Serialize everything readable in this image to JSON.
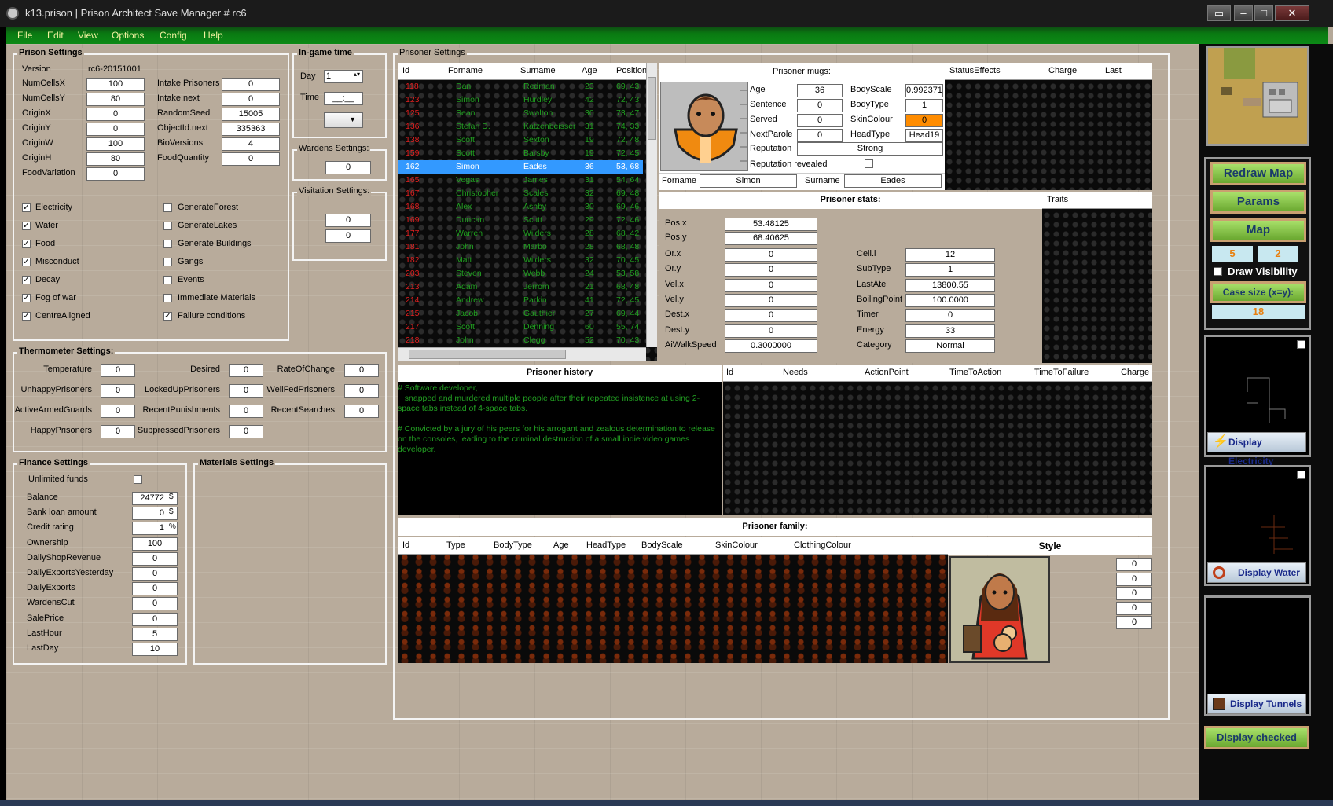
{
  "window": {
    "title": "k13.prison | Prison Architect Save Manager # rc6"
  },
  "menu": [
    "File",
    "Edit",
    "View",
    "Options",
    "Config",
    "Help"
  ],
  "prison_settings": {
    "title": "Prison Settings",
    "version_label": "Version",
    "version": "rc6-20151001",
    "left": [
      {
        "label": "NumCellsX",
        "value": "100"
      },
      {
        "label": "NumCellsY",
        "value": "80"
      },
      {
        "label": "OriginX",
        "value": "0"
      },
      {
        "label": "OriginY",
        "value": "0"
      },
      {
        "label": "OriginW",
        "value": "100"
      },
      {
        "label": "OriginH",
        "value": "80"
      },
      {
        "label": "FoodVariation",
        "value": "0"
      }
    ],
    "right": [
      {
        "label": "Intake Prisoners",
        "value": "0"
      },
      {
        "label": "Intake.next",
        "value": "0"
      },
      {
        "label": "RandomSeed",
        "value": "15005"
      },
      {
        "label": "ObjectId.next",
        "value": "335363"
      },
      {
        "label": "BioVersions",
        "value": "4"
      },
      {
        "label": "FoodQuantity",
        "value": "0"
      }
    ],
    "checks_left": [
      {
        "label": "Electricity",
        "checked": "✓"
      },
      {
        "label": "Water",
        "checked": "✓"
      },
      {
        "label": "Food",
        "checked": "✓"
      },
      {
        "label": "Misconduct",
        "checked": "✓"
      },
      {
        "label": "Decay",
        "checked": "✓"
      },
      {
        "label": "Fog of war",
        "checked": "✓"
      },
      {
        "label": "CentreAligned",
        "checked": "✓"
      }
    ],
    "checks_right": [
      {
        "label": "GenerateForest",
        "checked": ""
      },
      {
        "label": "GenerateLakes",
        "checked": ""
      },
      {
        "label": "Generate Buildings",
        "checked": ""
      },
      {
        "label": "Gangs",
        "checked": ""
      },
      {
        "label": "Events",
        "checked": ""
      },
      {
        "label": "Immediate Materials",
        "checked": ""
      },
      {
        "label": "Failure conditions",
        "checked": "✓"
      }
    ]
  },
  "ingame": {
    "title": "In-game time",
    "day_label": "Day",
    "day": "1",
    "time_label": "Time",
    "time": "__:__"
  },
  "wardens": {
    "title": "Wardens Settings:",
    "value": "0"
  },
  "visitation": {
    "title": "Visitation Settings:",
    "v1": "0",
    "v2": "0"
  },
  "thermometer": {
    "title": "Thermometer Settings:",
    "col1": [
      {
        "label": "Temperature",
        "value": "0"
      },
      {
        "label": "UnhappyPrisoners",
        "value": "0"
      },
      {
        "label": "ActiveArmedGuards",
        "value": "0"
      },
      {
        "label": "HappyPrisoners",
        "value": "0"
      }
    ],
    "col2": [
      {
        "label": "Desired",
        "value": "0"
      },
      {
        "label": "LockedUpPrisoners",
        "value": "0"
      },
      {
        "label": "RecentPunishments",
        "value": "0"
      },
      {
        "label": "SuppressedPrisoners",
        "value": "0"
      }
    ],
    "col3": [
      {
        "label": "RateOfChange",
        "value": "0"
      },
      {
        "label": "WellFedPrisoners",
        "value": "0"
      },
      {
        "label": "RecentSearches",
        "value": "0"
      }
    ]
  },
  "finance": {
    "title": "Finance Settings",
    "unlimited": "Unlimited funds",
    "rows": [
      {
        "label": "Balance",
        "value": "24772",
        "unit": "$"
      },
      {
        "label": "Bank loan amount",
        "value": "0",
        "unit": "$"
      },
      {
        "label": "Credit rating",
        "value": "1",
        "unit": "%"
      },
      {
        "label": "Ownership",
        "value": "100",
        "unit": ""
      },
      {
        "label": "DailyShopRevenue",
        "value": "0",
        "unit": ""
      },
      {
        "label": "DailyExportsYesterday",
        "value": "0",
        "unit": ""
      },
      {
        "label": "DailyExports",
        "value": "0",
        "unit": ""
      },
      {
        "label": "WardensCut",
        "value": "0",
        "unit": ""
      },
      {
        "label": "SalePrice",
        "value": "0",
        "unit": ""
      },
      {
        "label": "LastHour",
        "value": "5",
        "unit": ""
      },
      {
        "label": "LastDay",
        "value": "10",
        "unit": ""
      }
    ]
  },
  "materials": {
    "title": "Materials Settings"
  },
  "prisoner_settings": {
    "title": "Prisoner Settings",
    "columns": [
      "Id",
      "Forname",
      "Surname",
      "Age",
      "Position"
    ],
    "rows": [
      [
        "118",
        "Dan",
        "Redman",
        "23",
        "69, 43"
      ],
      [
        "123",
        "Simon",
        "Hurdley",
        "42",
        "72, 43"
      ],
      [
        "125",
        "Sean",
        "Swalton",
        "30",
        "73, 47"
      ],
      [
        "136",
        "Stefan D.",
        "Katzenbeisser",
        "31",
        "74, 33"
      ],
      [
        "138",
        "Scott",
        "Sexton",
        "19",
        "72, 48"
      ],
      [
        "159",
        "Scott",
        "Barsby",
        "19",
        "72, 45"
      ],
      [
        "162",
        "Simon",
        "Eades",
        "36",
        "53, 68"
      ],
      [
        "165",
        "Vegas",
        "James",
        "31",
        "54, 64"
      ],
      [
        "167",
        "Christopher",
        "Scales",
        "32",
        "69, 48"
      ],
      [
        "168",
        "Alex",
        "Ashby",
        "30",
        "69, 46"
      ],
      [
        "169",
        "Duncan",
        "Scutt",
        "29",
        "72, 46"
      ],
      [
        "177",
        "Warren",
        "Wilders",
        "28",
        "68, 42"
      ],
      [
        "181",
        "John",
        "Marbo",
        "28",
        "68, 48"
      ],
      [
        "182",
        "Matt",
        "Wilders",
        "32",
        "70, 45"
      ],
      [
        "203",
        "Steven",
        "Webb",
        "24",
        "53, 58"
      ],
      [
        "213",
        "Adam",
        "Jerrom",
        "21",
        "68, 48"
      ],
      [
        "214",
        "Andrew",
        "Parkin",
        "41",
        "72, 45"
      ],
      [
        "215",
        "Jacob",
        "Gauthier",
        "27",
        "69, 44"
      ],
      [
        "217",
        "Scott",
        "Denning",
        "60",
        "55, 74"
      ],
      [
        "218",
        "John",
        "Clegg",
        "52",
        "70, 43"
      ]
    ],
    "selected_row": "6"
  },
  "mugs": {
    "title": "Prisoner mugs:",
    "fields": [
      {
        "label": "Age",
        "value": "36"
      },
      {
        "label": "Sentence",
        "value": "0"
      },
      {
        "label": "Served",
        "value": "0"
      },
      {
        "label": "NextParole",
        "value": "0"
      }
    ],
    "fields2": [
      {
        "label": "BodyScale",
        "value": "0.992371"
      },
      {
        "label": "BodyType",
        "value": "1"
      },
      {
        "label": "SkinColour",
        "value": "0"
      },
      {
        "label": "HeadType",
        "value": "Head19"
      }
    ],
    "reputation_label": "Reputation",
    "reputation": "Strong",
    "revealed": "Reputation revealed",
    "forname_label": "Forname",
    "forname": "Simon",
    "surname_label": "Surname",
    "surname": "Eades",
    "skin_color": "#ff8c00"
  },
  "status_cols": [
    "StatusEffects",
    "Charge",
    "Last"
  ],
  "stats": {
    "title": "Prisoner stats:",
    "traits": "Traits",
    "pos": [
      {
        "label": "Pos.x",
        "value": "53.48125"
      },
      {
        "label": "Pos.y",
        "value": "68.40625"
      }
    ],
    "left": [
      {
        "label": "Or.x",
        "value": "0"
      },
      {
        "label": "Or.y",
        "value": "0"
      },
      {
        "label": "Vel.x",
        "value": "0"
      },
      {
        "label": "Vel.y",
        "value": "0"
      },
      {
        "label": "Dest.x",
        "value": "0"
      },
      {
        "label": "Dest.y",
        "value": "0"
      },
      {
        "label": "AiWalkSpeed",
        "value": "0.3000000"
      }
    ],
    "right": [
      {
        "label": "Cell.i",
        "value": "12"
      },
      {
        "label": "SubType",
        "value": "1"
      },
      {
        "label": "LastAte",
        "value": "13800.55"
      },
      {
        "label": "BoilingPoint",
        "value": "100.0000"
      },
      {
        "label": "Timer",
        "value": "0"
      },
      {
        "label": "Energy",
        "value": "33"
      },
      {
        "label": "Category",
        "value": "Normal"
      }
    ]
  },
  "history": {
    "title": "Prisoner history",
    "text": "# Software developer,\n   snapped and murdered multiple people after their repeated insistence at using 2-space tabs instead of 4-space tabs.\n\n# Convicted by a jury of his peers for his arrogant and zealous determination to release on the consoles, leading to the criminal destruction of a small indie video games developer."
  },
  "needs_cols": [
    "Id",
    "Needs",
    "ActionPoint",
    "TimeToAction",
    "TimeToFailure",
    "Charge"
  ],
  "family": {
    "title": "Prisoner family:",
    "cols": [
      "Id",
      "Type",
      "BodyType",
      "Age",
      "HeadType",
      "BodyScale",
      "SkinColour",
      "ClothingColour"
    ],
    "style": "Style",
    "values": [
      "0",
      "0",
      "0",
      "0",
      "0"
    ]
  },
  "sidebar": {
    "redraw": "Redraw Map",
    "params": "Params",
    "map": "Map",
    "v1": "5",
    "v2": "2",
    "draw_visibility": "Draw Visibility",
    "case_size": "Case size (x=y):",
    "case_value": "18",
    "electricity": "Display Electricity",
    "water": "Display Water",
    "tunnels": "Display Tunnels",
    "checked": "Display checked"
  }
}
